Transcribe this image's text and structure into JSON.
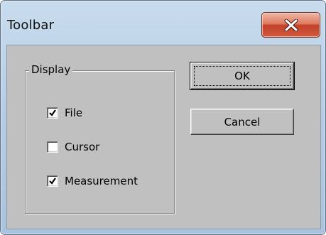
{
  "window": {
    "title": "Toolbar"
  },
  "group": {
    "legend": "Display",
    "checkboxes": [
      {
        "label": "File",
        "checked": true
      },
      {
        "label": "Cursor",
        "checked": false
      },
      {
        "label": "Measurement",
        "checked": true
      }
    ]
  },
  "buttons": {
    "ok_label": "OK",
    "cancel_label": "Cancel"
  },
  "icons": {
    "close": "close-icon",
    "check": "checkmark-icon"
  },
  "colors": {
    "close_button": "#c4402a",
    "dialog_face": "#c0c0c0",
    "title_bar": "#b6cde4"
  }
}
